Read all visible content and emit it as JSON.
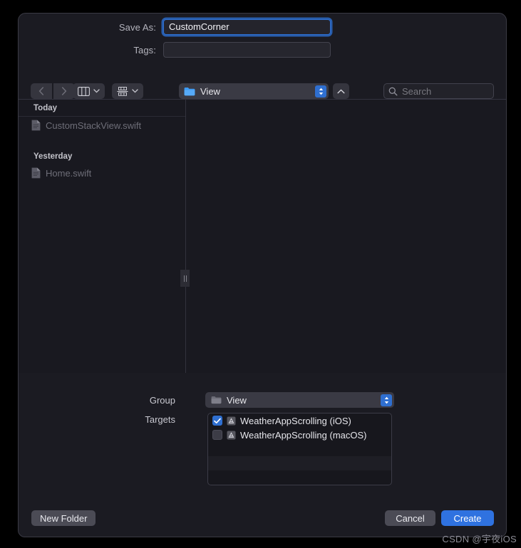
{
  "dialog": {
    "form": {
      "save_as_label": "Save As:",
      "save_as_value": "CustomCorner",
      "tags_label": "Tags:",
      "tags_value": "",
      "tags_placeholder": ""
    },
    "toolbar": {
      "back_icon": "chevron-left-icon",
      "forward_icon": "chevron-right-icon",
      "view_mode_icon": "column-view-icon",
      "group_by_icon": "group-by-icon",
      "chevron_icon": "chevron-down-icon",
      "path_label": "View",
      "path_folder_icon": "blue-folder-icon",
      "stepper_icon": "up-down-stepper-icon",
      "up_button_icon": "chevron-up-icon",
      "search_icon": "search-icon",
      "search_value": "",
      "search_placeholder": "Search"
    },
    "browser": {
      "sections": [
        {
          "header": "Today",
          "files": [
            {
              "name": "CustomStackView.swift",
              "icon": "document-icon"
            }
          ]
        },
        {
          "header": "Yesterday",
          "files": [
            {
              "name": "Home.swift",
              "icon": "document-icon"
            }
          ]
        }
      ],
      "split_handle_icon": "column-resize-handle-icon"
    },
    "options": {
      "group_label": "Group",
      "group_value": "View",
      "group_folder_icon": "gray-folder-icon",
      "group_stepper_icon": "up-down-stepper-icon",
      "targets_label": "Targets",
      "targets": [
        {
          "name": "WeatherAppScrolling (iOS)",
          "checked": true,
          "icon": "xcode-target-icon"
        },
        {
          "name": "WeatherAppScrolling (macOS)",
          "checked": false,
          "icon": "xcode-target-icon"
        }
      ]
    },
    "footer": {
      "new_folder_label": "New Folder",
      "cancel_label": "Cancel",
      "create_label": "Create"
    }
  },
  "watermark": {
    "text": "CSDN @宇夜iOS"
  },
  "colors": {
    "accent_blue": "#2f72e0",
    "window_bg": "#1b1b22",
    "browser_bg": "#191920",
    "control_bg": "#35353e",
    "text_primary": "#e9e9ee",
    "text_secondary": "#b4b4bd",
    "text_disabled": "#6e6e78"
  }
}
